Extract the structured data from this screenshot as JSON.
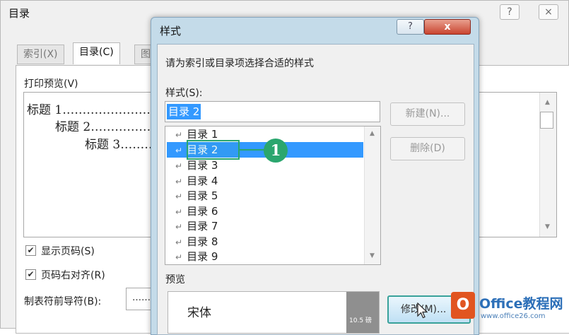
{
  "background_window": {
    "title": "目录",
    "help_button": "?",
    "close_button": "×",
    "tabs": [
      {
        "label": "索引(X)",
        "active": false
      },
      {
        "label": "目录(C)",
        "active": true
      },
      {
        "label": "图",
        "active": false
      }
    ],
    "print_preview_label": "打印预览(V)",
    "print_preview_lines": [
      "标题 1………………………",
      "标题 2…………………",
      "标题 3…………"
    ],
    "checkboxes": [
      {
        "label": "显示页码(S)",
        "checked": true
      },
      {
        "label": "页码右对齐(R)",
        "checked": true
      }
    ],
    "tab_leader_label": "制表符前导符(B):",
    "tab_leader_value": "……"
  },
  "dialog": {
    "title": "样式",
    "help_button": "?",
    "close_button": "x",
    "instruction": "请为索引或目录项选择合适的样式",
    "style_label": "样式(S):",
    "style_input_value": "目录 2",
    "new_button": "新建(N)...",
    "delete_button": "删除(D)",
    "style_list": [
      {
        "label": "目录 1",
        "selected": false
      },
      {
        "label": "目录 2",
        "selected": true
      },
      {
        "label": "目录 3",
        "selected": false
      },
      {
        "label": "目录 4",
        "selected": false
      },
      {
        "label": "目录 5",
        "selected": false
      },
      {
        "label": "目录 6",
        "selected": false
      },
      {
        "label": "目录 7",
        "selected": false
      },
      {
        "label": "目录 8",
        "selected": false
      },
      {
        "label": "目录 9",
        "selected": false
      }
    ],
    "preview_label": "预览",
    "preview_font": "宋体",
    "preview_size": "10.5 磅",
    "modify_button": "修改(M)..."
  },
  "annotation": {
    "step_number": "1"
  },
  "colors": {
    "accent_green": "#2aa66e",
    "selection_blue": "#3399ff",
    "close_red": "#c94530"
  },
  "watermark": {
    "brand": "Office教程网",
    "url": "www.office26.com"
  }
}
